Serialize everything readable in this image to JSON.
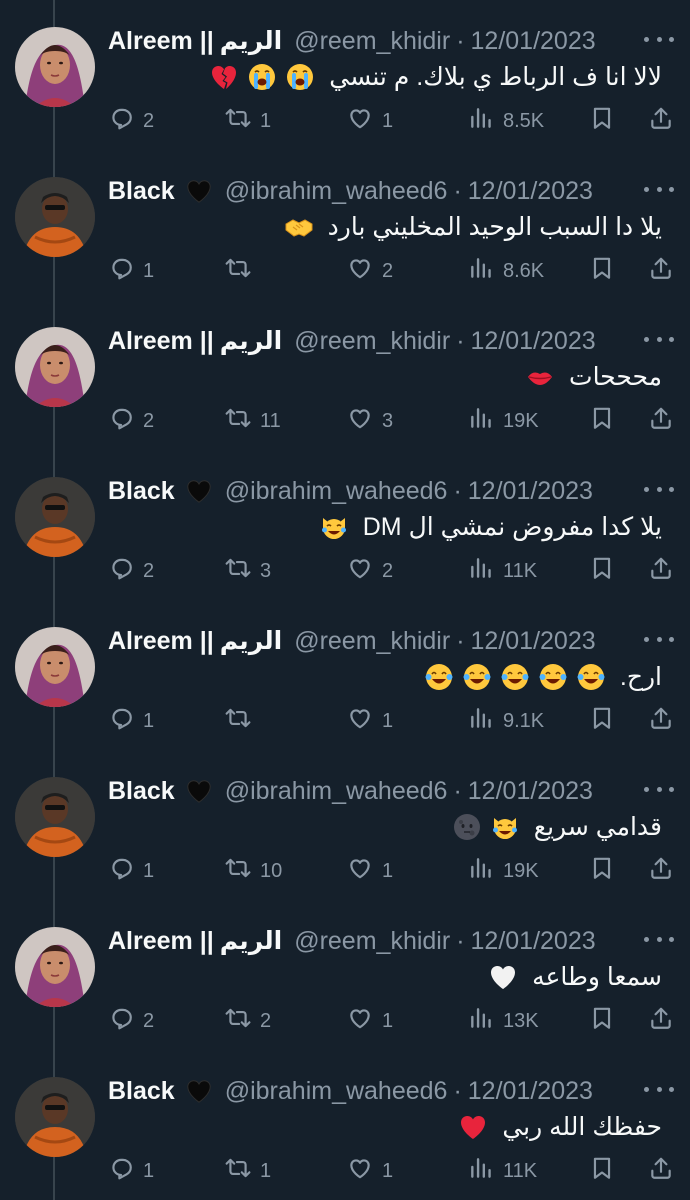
{
  "tweets": [
    {
      "author": "alreem",
      "name_en": "Alreem ||",
      "name_ar": "الريم",
      "handle": "@reem_khidir",
      "date": "12/01/2023",
      "text": "لالا انا ف الرباط ي بلاك. م تنسي",
      "emojis": [
        "loudly-crying-face",
        "loudly-crying-face",
        "broken-heart"
      ],
      "replies": "2",
      "retweets": "1",
      "likes": "1",
      "views": "8.5K"
    },
    {
      "author": "black",
      "name_en": "Black",
      "name_ar": "",
      "handle": "@ibrahim_waheed6",
      "date": "12/01/2023",
      "text": "يلا دا السبب الوحيد المخليني بارد",
      "emojis": [
        "handshake"
      ],
      "replies": "1",
      "retweets": "",
      "likes": "2",
      "views": "8.6K"
    },
    {
      "author": "alreem",
      "name_en": "Alreem ||",
      "name_ar": "الريم",
      "handle": "@reem_khidir",
      "date": "12/01/2023",
      "text": "محححات",
      "emojis": [
        "kiss-mark"
      ],
      "replies": "2",
      "retweets": "11",
      "likes": "3",
      "views": "19K"
    },
    {
      "author": "black",
      "name_en": "Black",
      "name_ar": "",
      "handle": "@ibrahim_waheed6",
      "date": "12/01/2023",
      "text": "يلا كدا مفروض نمشي ال DM",
      "emojis": [
        "cat-tears-of-joy"
      ],
      "replies": "2",
      "retweets": "3",
      "likes": "2",
      "views": "11K"
    },
    {
      "author": "alreem",
      "name_en": "Alreem ||",
      "name_ar": "الريم",
      "handle": "@reem_khidir",
      "date": "12/01/2023",
      "text": "ارح.",
      "emojis": [
        "tears-of-joy",
        "tears-of-joy",
        "tears-of-joy",
        "tears-of-joy",
        "tears-of-joy"
      ],
      "replies": "1",
      "retweets": "",
      "likes": "1",
      "views": "9.1K"
    },
    {
      "author": "black",
      "name_en": "Black",
      "name_ar": "",
      "handle": "@ibrahim_waheed6",
      "date": "12/01/2023",
      "text": "قدامي سريع",
      "emojis": [
        "cat-tears-of-joy",
        "new-moon-face"
      ],
      "replies": "1",
      "retweets": "10",
      "likes": "1",
      "views": "19K"
    },
    {
      "author": "alreem",
      "name_en": "Alreem ||",
      "name_ar": "الريم",
      "handle": "@reem_khidir",
      "date": "12/01/2023",
      "text": "سمعا وطاعه",
      "emojis": [
        "white-heart"
      ],
      "replies": "2",
      "retweets": "2",
      "likes": "1",
      "views": "13K"
    },
    {
      "author": "black",
      "name_en": "Black",
      "name_ar": "",
      "handle": "@ibrahim_waheed6",
      "date": "12/01/2023",
      "text": "حفظك الله ربي",
      "emojis": [
        "red-heart"
      ],
      "replies": "1",
      "retweets": "1",
      "likes": "1",
      "views": "11K"
    }
  ],
  "colors": {
    "background": "#15202b",
    "text": "#f7f9f9",
    "muted": "#8b98a5",
    "thread_line": "#38444d"
  },
  "icons": {
    "reply": "reply-icon",
    "retweet": "retweet-icon",
    "like": "like-icon",
    "views": "views-icon",
    "bookmark": "bookmark-icon",
    "share": "share-icon",
    "more": "more-icon",
    "black_heart": "black-heart-icon"
  }
}
